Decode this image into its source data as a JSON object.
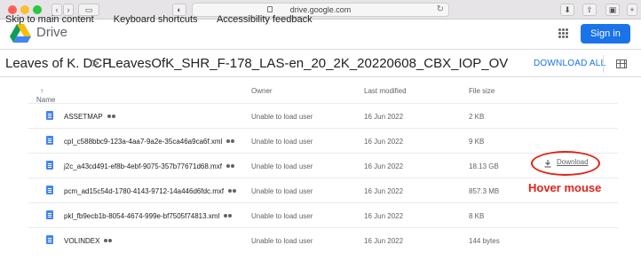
{
  "browser": {
    "url": "drive.google.com",
    "skip_links": [
      "Skip to main content",
      "Keyboard shortcuts",
      "Accessibility feedback"
    ]
  },
  "header": {
    "brand": "Drive",
    "signin_label": "Sign in"
  },
  "folder": {
    "breadcrumb_root": "Leaves of K. DCP",
    "breadcrumb_sep": ">",
    "breadcrumb_current": "LeavesOfK_SHR_F-178_LAS-en_20_2K_20220608_CBX_IOP_OV",
    "download_all_label": "DOWNLOAD ALL"
  },
  "table": {
    "columns": [
      "Name",
      "Owner",
      "Last modified",
      "File size"
    ],
    "sort_arrow": "↑",
    "rows": [
      {
        "name": "ASSETMAP",
        "owner": "Unable to load user",
        "modified": "16 Jun 2022",
        "size": "2 KB"
      },
      {
        "name": "cpl_c588bbc9-123a-4aa7-9a2e-35ca46a9ca6f.xml",
        "owner": "Unable to load user",
        "modified": "16 Jun 2022",
        "size": "9 KB"
      },
      {
        "name": "j2c_a43cd491-ef8b-4ebf-9075-357b77671d68.mxf",
        "owner": "Unable to load user",
        "modified": "16 Jun 2022",
        "size": "18.13 GB"
      },
      {
        "name": "pcm_ad15c54d-1780-4143-9712-14a446d6fdc.mxf",
        "owner": "Unable to load user",
        "modified": "16 Jun 2022",
        "size": "857.3 MB"
      },
      {
        "name": "pkl_fb9ecb1b-8054-4674-999e-bf7505f74813.xml",
        "owner": "Unable to load user",
        "modified": "16 Jun 2022",
        "size": "8 KB"
      },
      {
        "name": "VOLINDEX",
        "owner": "Unable to load user",
        "modified": "16 Jun 2022",
        "size": "144 bytes"
      }
    ]
  },
  "hover": {
    "download_label": "Download",
    "annotation": "Hover mouse",
    "annotation_color": "#e2231a"
  }
}
